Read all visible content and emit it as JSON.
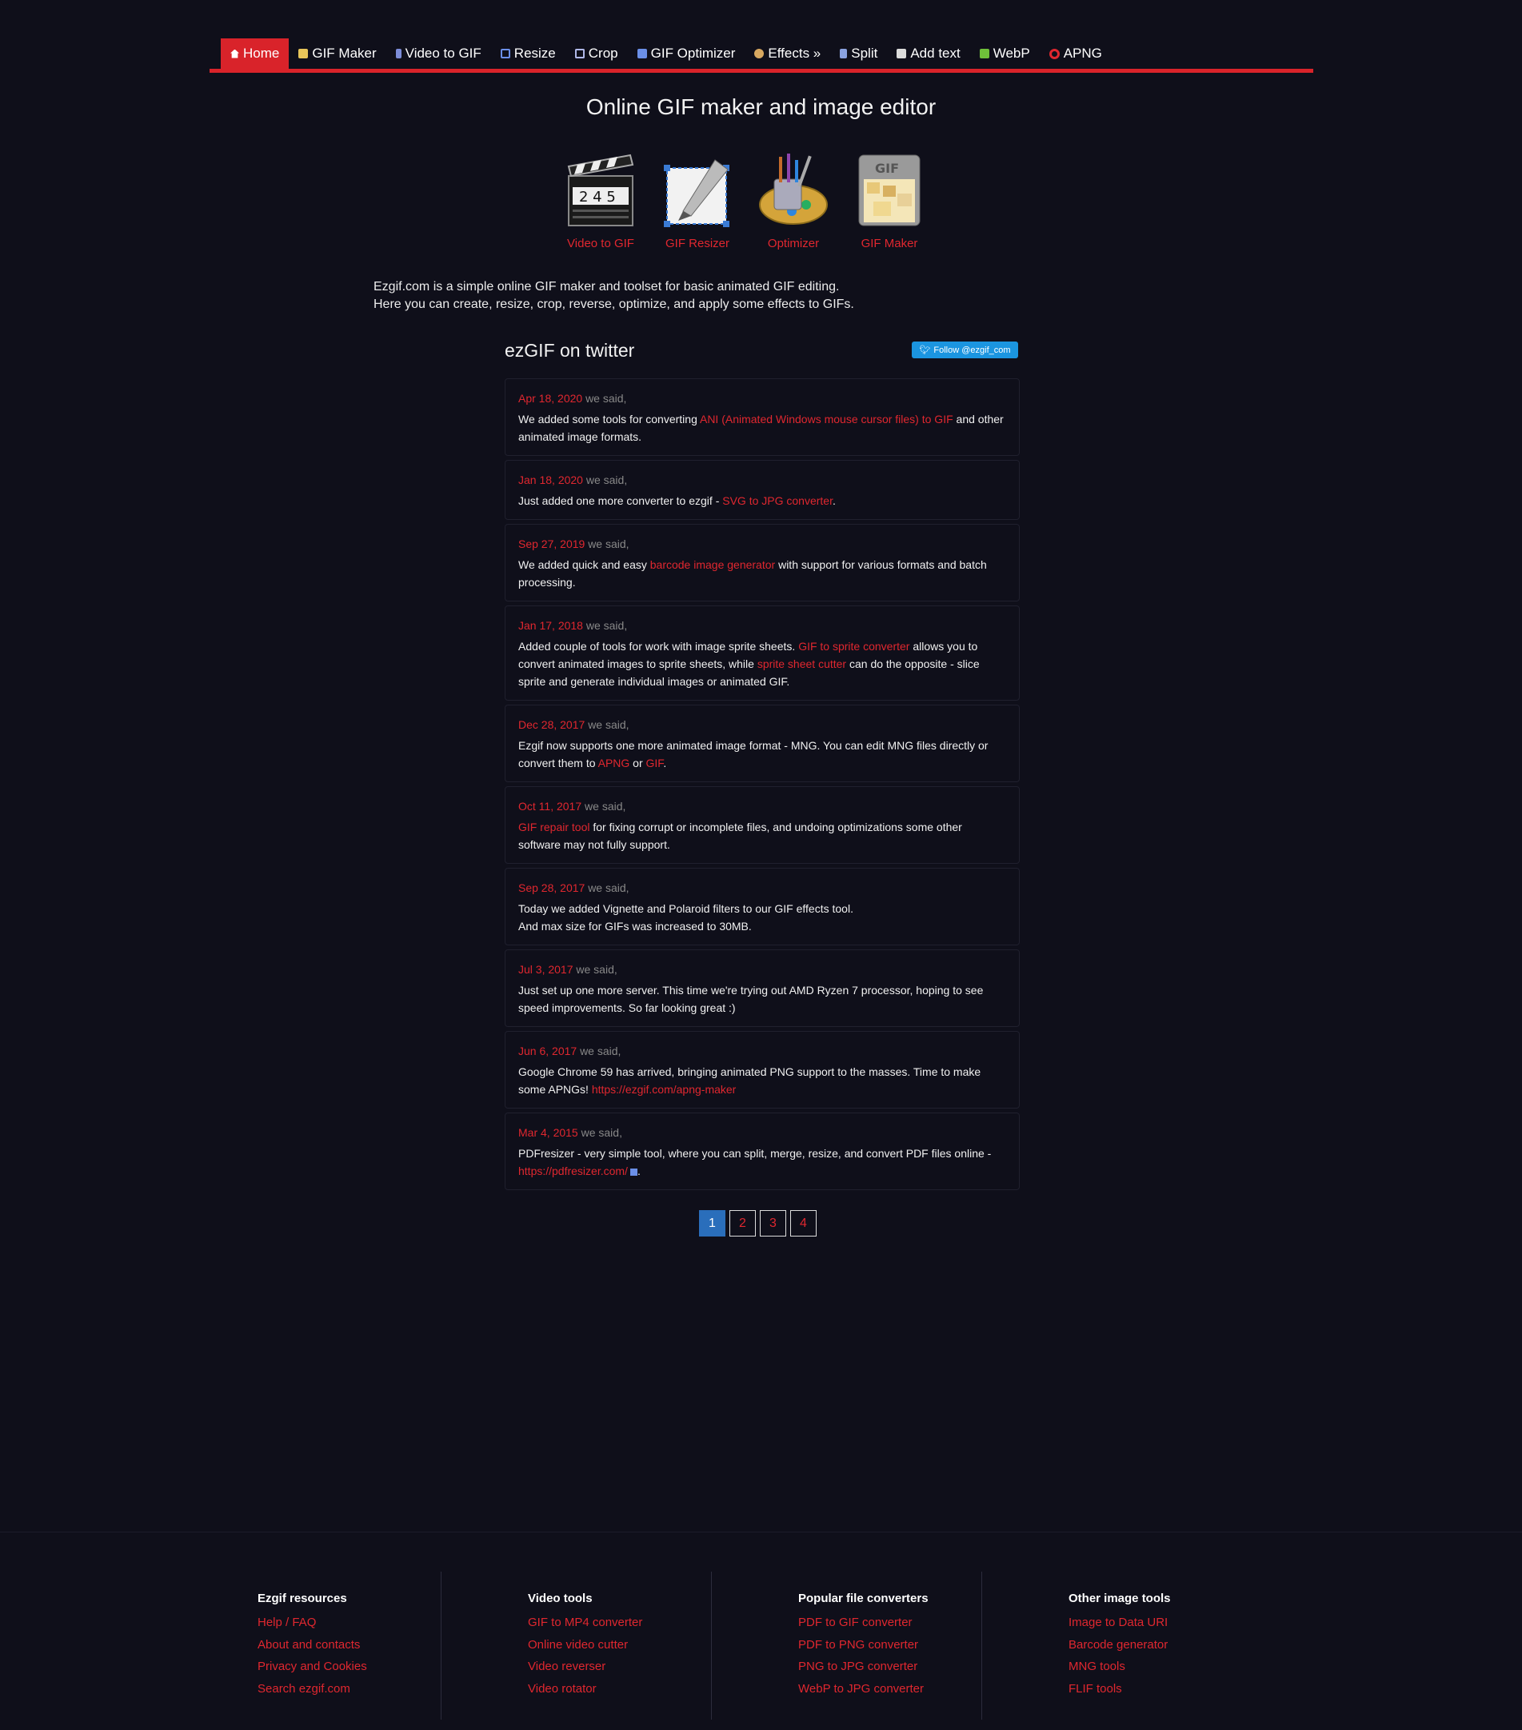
{
  "nav": {
    "items": [
      {
        "label": "Home",
        "icon": "home-icon",
        "active": true
      },
      {
        "label": "GIF Maker",
        "icon": "gif-maker-icon"
      },
      {
        "label": "Video to GIF",
        "icon": "film-icon"
      },
      {
        "label": "Resize",
        "icon": "resize-icon"
      },
      {
        "label": "Crop",
        "icon": "crop-icon"
      },
      {
        "label": "GIF Optimizer",
        "icon": "optimizer-icon"
      },
      {
        "label": "Effects »",
        "icon": "effects-icon"
      },
      {
        "label": "Split",
        "icon": "split-icon"
      },
      {
        "label": "Add text",
        "icon": "text-icon"
      },
      {
        "label": "WebP",
        "icon": "webp-icon"
      },
      {
        "label": "APNG",
        "icon": "apng-icon"
      }
    ]
  },
  "page_title": "Online GIF maker and image editor",
  "tools": [
    {
      "label": "Video to GIF",
      "icon": "clapperboard-icon"
    },
    {
      "label": "GIF Resizer",
      "icon": "resizer-pen-icon"
    },
    {
      "label": "Optimizer",
      "icon": "paint-brushes-icon"
    },
    {
      "label": "GIF Maker",
      "icon": "gif-document-icon"
    }
  ],
  "intro": {
    "line1": "Ezgif.com is a simple online GIF maker and toolset for basic animated GIF editing.",
    "line2": "Here you can create, resize, crop, reverse, optimize, and apply some effects to GIFs."
  },
  "twitter": {
    "heading": "ezGIF on twitter",
    "follow_label": "Follow @ezgif_com",
    "said": "we said,"
  },
  "tweets": [
    {
      "date": "Apr 18, 2020",
      "parts": [
        "We added some tools for converting ",
        "ANI (Animated Windows mouse cursor files) to GIF",
        " and other animated image formats."
      ]
    },
    {
      "date": "Jan 18, 2020",
      "parts": [
        "Just added one more converter to ezgif - ",
        "SVG to JPG converter",
        "."
      ]
    },
    {
      "date": "Sep 27, 2019",
      "parts": [
        "We added quick and easy ",
        "barcode image generator",
        " with support for various formats and batch processing."
      ]
    },
    {
      "date": "Jan 17, 2018",
      "parts": [
        "Added couple of tools for work with image sprite sheets. ",
        "GIF to sprite converter",
        " allows you to convert animated images to sprite sheets, while ",
        "sprite sheet cutter",
        " can do the opposite - slice sprite and generate individual images or animated GIF."
      ]
    },
    {
      "date": "Dec 28, 2017",
      "parts": [
        "Ezgif now supports one more animated image format - MNG. You can edit MNG files directly or convert them to ",
        "APNG",
        " or ",
        "GIF",
        "."
      ]
    },
    {
      "date": "Oct 11, 2017",
      "parts": [
        "",
        "GIF repair tool",
        " for fixing corrupt or incomplete files, and undoing optimizations some other software may not fully support."
      ]
    },
    {
      "date": "Sep 28, 2017",
      "parts": [
        "Today we added Vignette and Polaroid filters to our GIF effects tool.\nAnd max size for GIFs was increased to 30MB."
      ]
    },
    {
      "date": "Jul 3, 2017",
      "parts": [
        "Just set up one more server. This time we're trying out AMD Ryzen 7 processor, hoping to see speed improvements. So far looking great :)"
      ]
    },
    {
      "date": "Jun 6, 2017",
      "parts": [
        "Google Chrome 59 has arrived, bringing animated PNG support to the masses. Time to make some APNGs! ",
        "https://ezgif.com/apng-maker",
        ""
      ]
    },
    {
      "date": "Mar 4, 2015",
      "parts": [
        "PDFresizer - very simple tool, where you can split, merge, resize, and convert PDF files online - ",
        "https://pdfresizer.com/",
        "."
      ]
    }
  ],
  "pagination": {
    "pages": [
      "1",
      "2",
      "3",
      "4"
    ],
    "current": "1"
  },
  "footer": {
    "columns": [
      {
        "title": "Ezgif resources",
        "links": [
          "Help / FAQ",
          "About and contacts",
          "Privacy and Cookies",
          "Search ezgif.com"
        ]
      },
      {
        "title": "Video tools",
        "links": [
          "GIF to MP4 converter",
          "Online video cutter",
          "Video reverser",
          "Video rotator"
        ]
      },
      {
        "title": "Popular file converters",
        "links": [
          "PDF to GIF converter",
          "PDF to PNG converter",
          "PNG to JPG converter",
          "WebP to JPG converter"
        ]
      },
      {
        "title": "Other image tools",
        "links": [
          "Image to Data URI",
          "Barcode generator",
          "MNG tools",
          "FLIF tools"
        ]
      }
    ]
  },
  "colors": {
    "accent": "#d9232a",
    "background": "#0f0f1a",
    "link": "#e0272f",
    "twitter": "#1b95e0",
    "pager_active": "#2a6ebb"
  }
}
